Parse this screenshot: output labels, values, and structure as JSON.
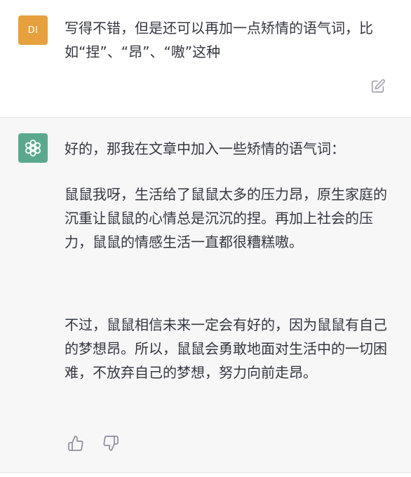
{
  "user_message": {
    "avatar_initials": "DI",
    "avatar_color": "#e6a03d",
    "text": "写得不错，但是还可以再加一点矫情的语气词，比如“捏”、“昂”、“嗷”这种"
  },
  "assistant_message": {
    "avatar_color": "#5ba88f",
    "avatar_icon": "openai-logo-icon",
    "intro": "好的，那我在文章中加入一些矫情的语气词：",
    "paragraph_1": "鼠鼠我呀，生活给了鼠鼠太多的压力昂，原生家庭的沉重让鼠鼠的心情总是沉沉的捏。再加上社会的压力，鼠鼠的情感生活一直都很糟糕嗷。",
    "paragraph_2": "不过，鼠鼠相信未来一定会有好的，因为鼠鼠有自己的梦想昂。所以，鼠鼠会勇敢地面对生活中的一切困难，不放弃自己的梦想，努力向前走昂。"
  },
  "icons": {
    "edit": "edit-icon",
    "like": "thumbs-up-icon",
    "dislike": "thumbs-down-icon"
  }
}
